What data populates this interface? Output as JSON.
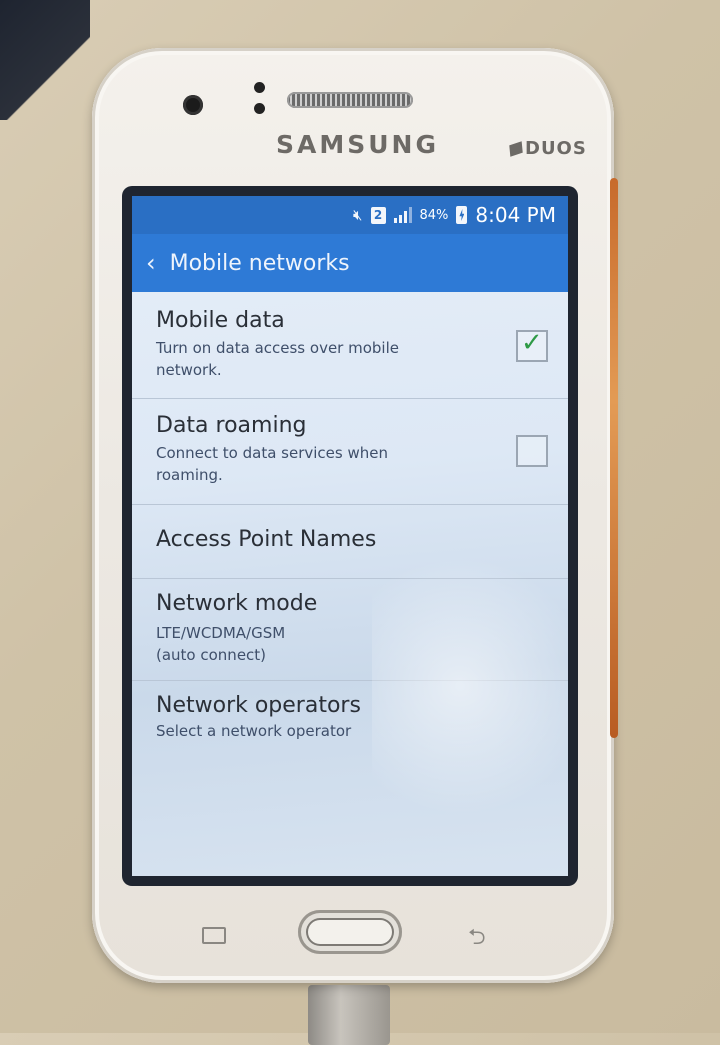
{
  "device": {
    "brand": "SAMSUNG",
    "badge": "DUOS"
  },
  "status_bar": {
    "sim_slot": "2",
    "battery_pct": "84%",
    "time": "8:04 PM"
  },
  "action_bar": {
    "title": "Mobile networks"
  },
  "settings": [
    {
      "title": "Mobile data",
      "summary": "Turn on data access over mobile network.",
      "checked": true
    },
    {
      "title": "Data roaming",
      "summary": "Connect to data services when roaming.",
      "checked": false
    },
    {
      "title": "Access Point Names",
      "summary": ""
    },
    {
      "title": "Network mode",
      "summary_line1": "LTE/WCDMA/GSM",
      "summary_line2": "(auto connect)"
    },
    {
      "title": "Network operators",
      "summary": "Select a network operator"
    }
  ],
  "colors": {
    "status_bar": "#2a6fc4",
    "action_bar": "#2e7ad6",
    "check": "#2e9a46"
  },
  "icons": [
    "mute-icon",
    "signal-icon",
    "battery-charging-icon",
    "back-chevron-icon",
    "recent-apps-icon",
    "back-icon"
  ]
}
